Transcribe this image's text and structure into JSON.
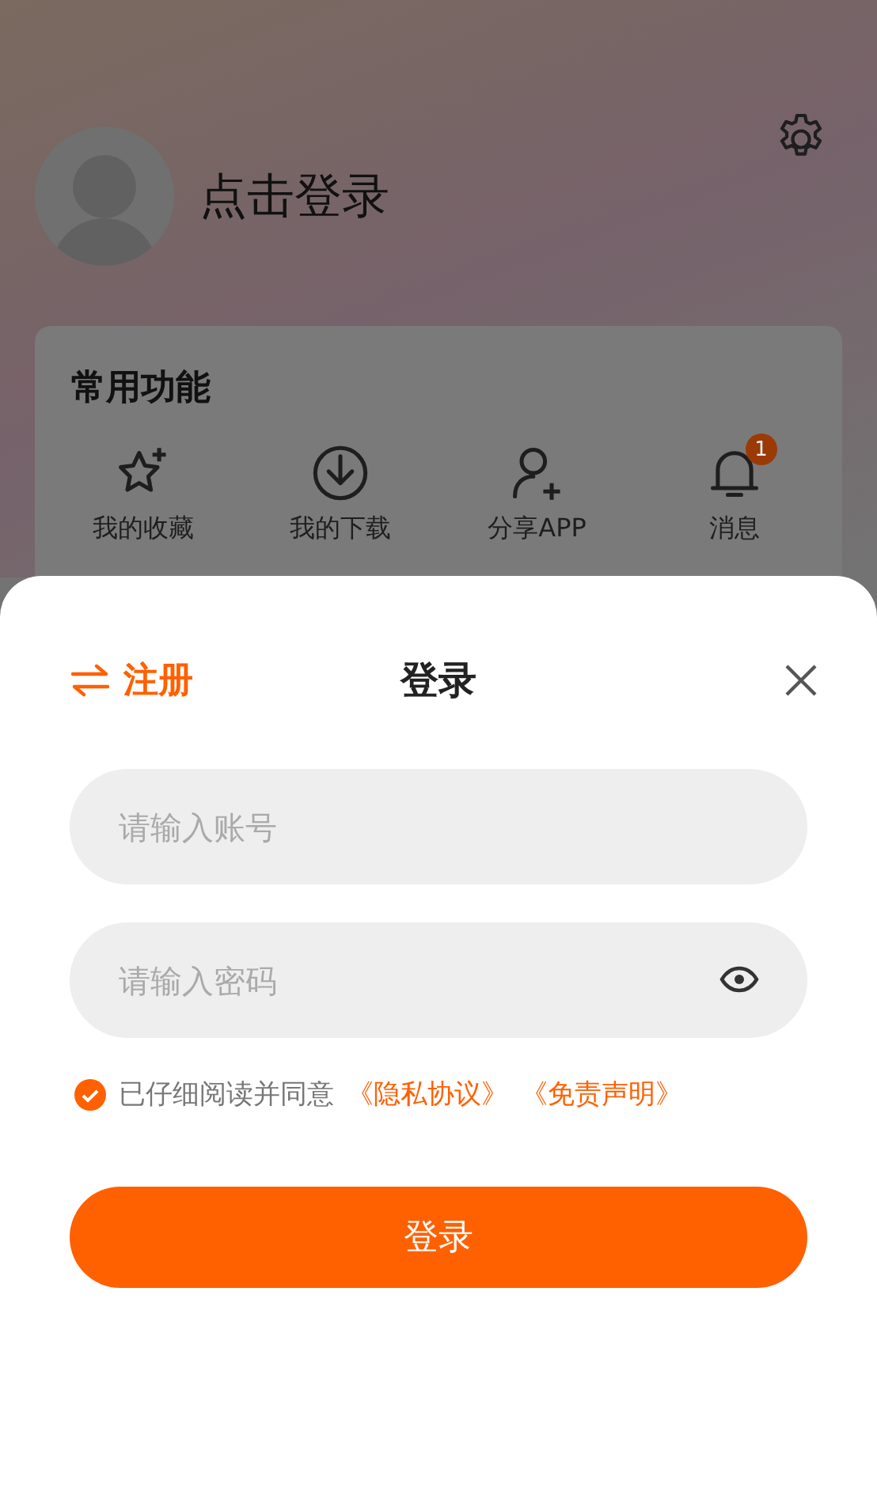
{
  "header": {
    "login_prompt": "点击登录"
  },
  "features": {
    "title": "常用功能",
    "items": [
      {
        "kind": "favorites",
        "label": "我的收藏"
      },
      {
        "kind": "downloads",
        "label": "我的下载"
      },
      {
        "kind": "share",
        "label": "分享APP"
      },
      {
        "kind": "messages",
        "label": "消息",
        "badge": "1"
      }
    ]
  },
  "login_sheet": {
    "register_link": "注册",
    "title": "登录",
    "fields": [
      {
        "kind": "text",
        "placeholder": "请输入账号"
      },
      {
        "kind": "password",
        "placeholder": "请输入密码"
      }
    ],
    "agreement": {
      "checked": true,
      "text": "已仔细阅读并同意",
      "links": [
        "《隐私协议》",
        "《免责声明》"
      ]
    },
    "submit": "登录"
  }
}
